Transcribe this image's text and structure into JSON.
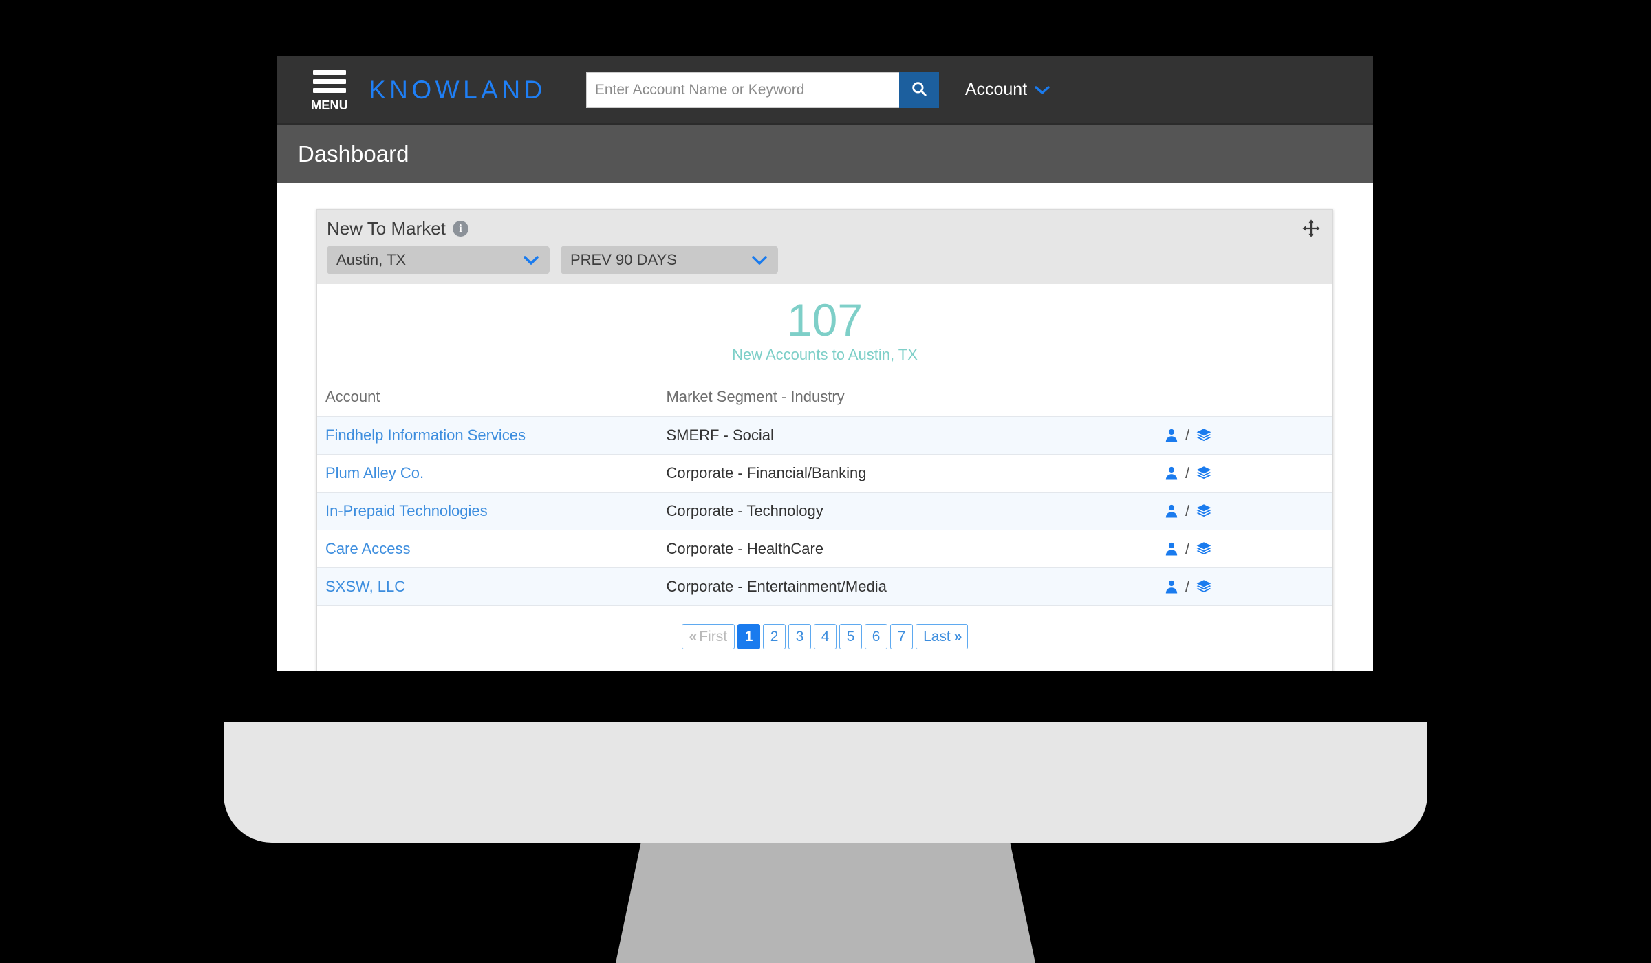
{
  "topnav": {
    "menu_label": "MENU",
    "menu_icon": "hamburger-menu-icon",
    "brand": "KNOWLAND",
    "search_placeholder": "Enter Account Name or Keyword",
    "search_value": "",
    "search_icon": "search-icon",
    "account_label": "Account",
    "account_caret_icon": "chevron-down-icon"
  },
  "page": {
    "title": "Dashboard"
  },
  "widget": {
    "title": "New To Market",
    "info_icon": "info-icon",
    "move_icon": "move-arrows-icon",
    "market_select": {
      "value": "Austin, TX",
      "caret_icon": "chevron-down-icon"
    },
    "period_select": {
      "value": "PREV 90 DAYS",
      "caret_icon": "chevron-down-icon"
    },
    "stat": {
      "number": "107",
      "caption": "New Accounts to Austin, TX"
    },
    "table": {
      "headers": {
        "account": "Account",
        "segment": "Market Segment - Industry"
      },
      "rows": [
        {
          "account": "Findhelp Information Services",
          "segment": "SMERF - Social",
          "contact_icon": "person-icon",
          "separator": "/",
          "layers_icon": "layers-icon"
        },
        {
          "account": "Plum Alley Co.",
          "segment": "Corporate - Financial/Banking",
          "contact_icon": "person-icon",
          "separator": "/",
          "layers_icon": "layers-icon"
        },
        {
          "account": "In-Prepaid Technologies",
          "segment": "Corporate - Technology",
          "contact_icon": "person-icon",
          "separator": "/",
          "layers_icon": "layers-icon"
        },
        {
          "account": "Care Access",
          "segment": "Corporate - HealthCare",
          "contact_icon": "person-icon",
          "separator": "/",
          "layers_icon": "layers-icon"
        },
        {
          "account": "SXSW, LLC",
          "segment": "Corporate - Entertainment/Media",
          "contact_icon": "person-icon",
          "separator": "/",
          "layers_icon": "layers-icon"
        }
      ]
    },
    "pagination": {
      "first_label": "First",
      "first_icon": "double-chevron-left-icon",
      "pages": [
        "1",
        "2",
        "3",
        "4",
        "5",
        "6",
        "7"
      ],
      "active_page": "1",
      "last_label": "Last",
      "last_icon": "double-chevron-right-icon"
    }
  },
  "colors": {
    "brand_blue": "#1f7ff5",
    "search_button_blue": "#1c5f9e",
    "link_blue": "#3c8dde",
    "active_page_blue": "#1a7bee",
    "stat_teal": "#7ecfc8",
    "nav_dark": "#333333",
    "title_bar_gray": "#555555",
    "widget_header_gray": "#e6e6e6"
  }
}
